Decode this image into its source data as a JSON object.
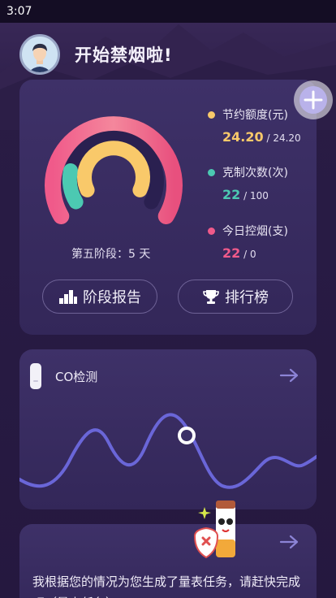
{
  "status_bar": {
    "time": "3:07"
  },
  "header": {
    "greeting": "开始禁烟啦!"
  },
  "main_card": {
    "stage_text": "第五阶段：5 天",
    "gauge": {
      "outer_color": "#f05a8a",
      "middle_color": "#4cc9b2",
      "inner_color": "#f9c96a"
    },
    "stats": [
      {
        "label": "节约额度(元)",
        "value": "24.20",
        "separator": "/",
        "total": "24.20",
        "color": "#f9c96a"
      },
      {
        "label": "克制次数(次)",
        "value": "22",
        "separator": "/",
        "total": "100",
        "color": "#4cc9b2"
      },
      {
        "label": "今日控烟(支)",
        "value": "22",
        "separator": "/",
        "total": "0",
        "color": "#f05a8a"
      }
    ],
    "buttons": {
      "report": "阶段报告",
      "ranking": "排行榜"
    }
  },
  "co_card": {
    "title": "CO检测",
    "wave_color": "#6a66d8"
  },
  "task_card": {
    "text": "我根据您的情况为您生成了量表任务，请赶快完成吧（量表任务）"
  }
}
